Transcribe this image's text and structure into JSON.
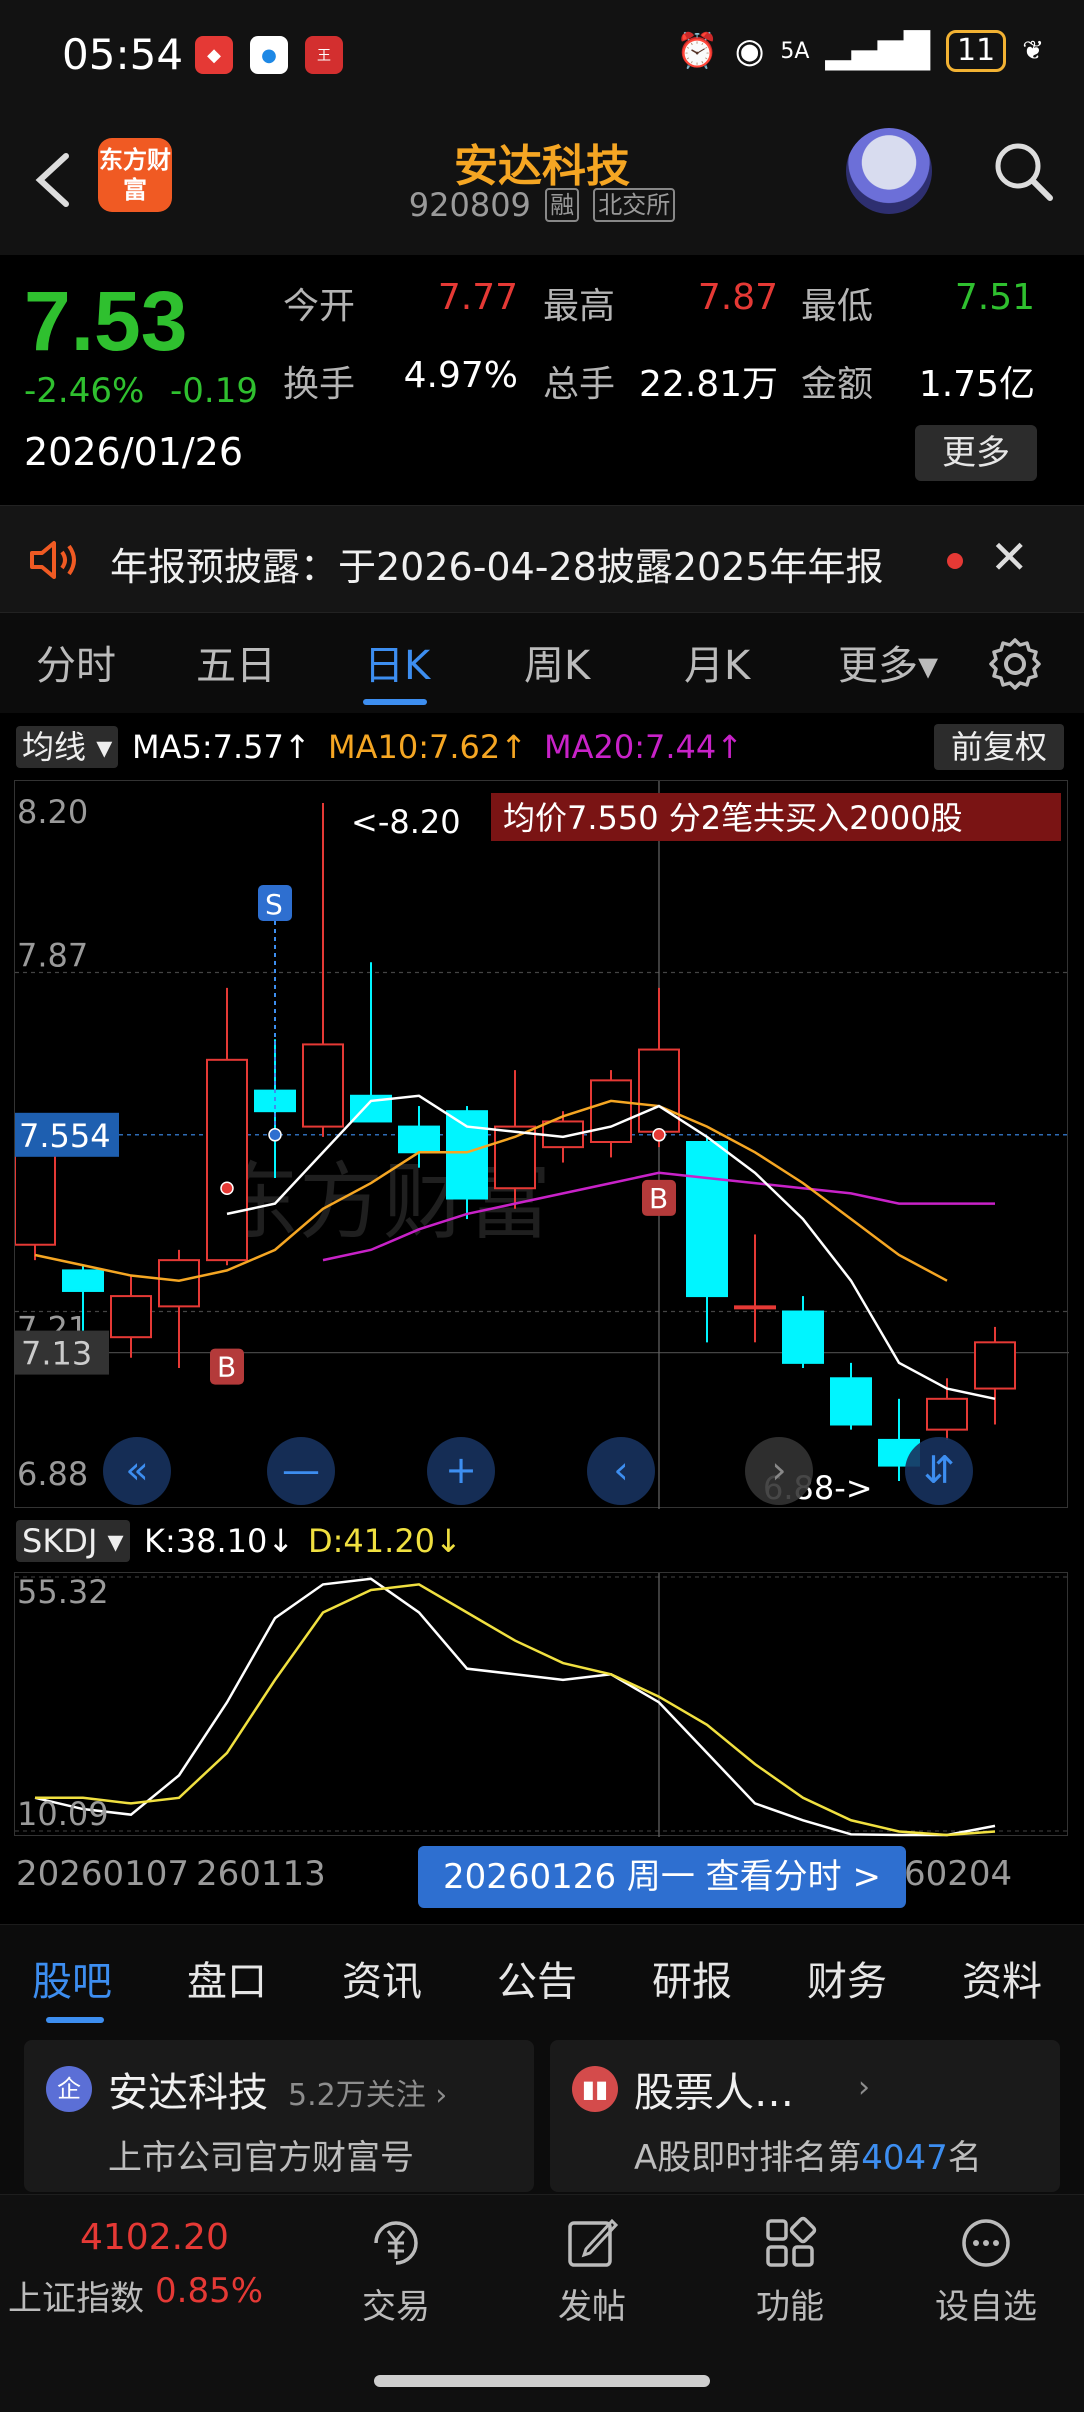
{
  "status_bar": {
    "time": "05:54",
    "network": "5A",
    "battery": "11"
  },
  "header": {
    "app_logo_text": "东方财富",
    "stock_name": "安达科技",
    "stock_code": "920809",
    "margin_tag": "融",
    "exchange_tag": "北交所"
  },
  "quote": {
    "last_price": "7.53",
    "change_pct": "-2.46%",
    "change_abs": "-0.19",
    "date": "2026/01/26",
    "fields": [
      {
        "label": "今开",
        "value": "7.77",
        "color": "#e53935"
      },
      {
        "label": "最高",
        "value": "7.87",
        "color": "#e53935"
      },
      {
        "label": "最低",
        "value": "7.51",
        "color": "#2fc02f"
      },
      {
        "label": "换手",
        "value": "4.97%",
        "color": "#ffffff"
      },
      {
        "label": "总手",
        "value": "22.81万",
        "color": "#ffffff"
      },
      {
        "label": "金额",
        "value": "1.75亿",
        "color": "#ffffff"
      }
    ],
    "more_label": "更多"
  },
  "notice": {
    "text": "年报预披露：于2026-04-28披露2025年年报"
  },
  "period_tabs": {
    "items": [
      "分时",
      "五日",
      "日K",
      "周K",
      "月K",
      "更多▾"
    ],
    "active": "日K"
  },
  "ma_bar": {
    "selector": "均线",
    "ma5": "MA5:7.57↑",
    "ma10": "MA10:7.62↑",
    "ma20": "MA20:7.44↑",
    "adjust": "前复权"
  },
  "kdj_bar": {
    "selector": "SKDJ",
    "k": "K:38.10↓",
    "d": "D:41.20↓"
  },
  "colors": {
    "up": "#e53935",
    "down": "#00f5ff",
    "ma5": "#ffffff",
    "ma10": "#f5a623",
    "ma20": "#c822c8",
    "k_line": "#ffffff",
    "d_line": "#f0e040",
    "accent": "#3d8ef0"
  },
  "chart_data": [
    {
      "type": "candlestick",
      "y_ticks": [
        "8.20",
        "7.87",
        "7.554",
        "7.21",
        "7.13",
        "6.88"
      ],
      "ylim": [
        6.88,
        8.2
      ],
      "crosshair_value": "7.554",
      "max_label": "<-8.20",
      "min_label": "6.88->",
      "banner": "均价7.550  分2笔共买入2000股",
      "candles": [
        {
          "o": 7.34,
          "h": 7.52,
          "l": 7.31,
          "c": 7.52
        },
        {
          "o": 7.29,
          "h": 7.3,
          "l": 7.15,
          "c": 7.25
        },
        {
          "o": 7.16,
          "h": 7.28,
          "l": 7.12,
          "c": 7.24
        },
        {
          "o": 7.22,
          "h": 7.33,
          "l": 7.1,
          "c": 7.31
        },
        {
          "o": 7.31,
          "h": 7.84,
          "l": 7.3,
          "c": 7.7
        },
        {
          "o": 7.64,
          "h": 7.74,
          "l": 7.47,
          "c": 7.6
        },
        {
          "o": 7.57,
          "h": 8.2,
          "l": 7.55,
          "c": 7.73
        },
        {
          "o": 7.63,
          "h": 7.89,
          "l": 7.58,
          "c": 7.58
        },
        {
          "o": 7.57,
          "h": 7.61,
          "l": 7.49,
          "c": 7.52
        },
        {
          "o": 7.6,
          "h": 7.61,
          "l": 7.39,
          "c": 7.43
        },
        {
          "o": 7.45,
          "h": 7.68,
          "l": 7.41,
          "c": 7.57
        },
        {
          "o": 7.53,
          "h": 7.6,
          "l": 7.5,
          "c": 7.58
        },
        {
          "o": 7.54,
          "h": 7.68,
          "l": 7.51,
          "c": 7.66
        },
        {
          "o": 7.56,
          "h": 7.84,
          "l": 7.53,
          "c": 7.72
        },
        {
          "o": 7.54,
          "h": 7.55,
          "l": 7.15,
          "c": 7.24
        },
        {
          "o": 7.22,
          "h": 7.36,
          "l": 7.15,
          "c": 7.22
        },
        {
          "o": 7.21,
          "h": 7.24,
          "l": 7.1,
          "c": 7.11
        },
        {
          "o": 7.08,
          "h": 7.11,
          "l": 6.98,
          "c": 6.99
        },
        {
          "o": 6.96,
          "h": 7.04,
          "l": 6.88,
          "c": 6.91
        },
        {
          "o": 6.98,
          "h": 7.08,
          "l": 6.96,
          "c": 7.04
        },
        {
          "o": 7.06,
          "h": 7.18,
          "l": 6.99,
          "c": 7.15
        }
      ],
      "ma5": [
        null,
        null,
        null,
        null,
        7.4,
        7.42,
        7.52,
        7.62,
        7.63,
        7.57,
        7.56,
        7.55,
        7.57,
        7.61,
        7.55,
        7.48,
        7.39,
        7.27,
        7.11,
        7.06,
        7.04
      ],
      "ma10": [
        7.32,
        7.3,
        7.28,
        7.27,
        7.29,
        7.33,
        7.41,
        7.46,
        7.52,
        7.52,
        7.55,
        7.59,
        7.62,
        7.61,
        7.57,
        7.52,
        7.46,
        7.39,
        7.32,
        7.27
      ],
      "ma20": [
        null,
        null,
        null,
        null,
        null,
        null,
        7.31,
        7.33,
        7.37,
        7.4,
        7.42,
        7.44,
        7.46,
        7.48,
        7.47,
        7.46,
        7.45,
        7.44,
        7.42,
        7.42,
        7.42
      ],
      "markers": [
        {
          "index": 5,
          "label": "S"
        },
        {
          "index": 4,
          "label": "B"
        },
        {
          "index": 13,
          "label": "B"
        }
      ]
    },
    {
      "type": "line",
      "title": "SKDJ",
      "y_ticks": [
        "55.32",
        "10.09"
      ],
      "ylim": [
        10.09,
        55.32
      ],
      "series": [
        {
          "name": "K",
          "values": [
            16,
            14,
            13,
            20,
            33,
            48,
            54,
            55,
            49,
            39,
            38,
            37,
            38,
            33,
            24,
            15,
            12,
            9.5,
            8,
            8,
            11
          ]
        },
        {
          "name": "D",
          "values": [
            16,
            16,
            15,
            16,
            24,
            37,
            49,
            53,
            54,
            49,
            44,
            40,
            38,
            34,
            29,
            22,
            16,
            12,
            10,
            9,
            10
          ]
        }
      ]
    }
  ],
  "date_axis": {
    "left": "20260107",
    "mid": "260113",
    "right": "60204",
    "tooltip": "20260126 周一 查看分时 >"
  },
  "bottom_tabs": {
    "items": [
      "股吧",
      "盘口",
      "资讯",
      "公告",
      "研报",
      "财务",
      "资料"
    ],
    "active": "股吧"
  },
  "cards": [
    {
      "icon_text": "企",
      "title": "安达科技",
      "sub": "5.2万关注 ›",
      "desc": "上市公司官方财富号"
    },
    {
      "title": "股票人…",
      "sub": "›",
      "desc_prefix": "A股即时排名第",
      "desc_rank": "4047",
      "desc_suffix": "名"
    }
  ],
  "bottom_nav": {
    "index_value": "4102.20",
    "index_name": "上证指数",
    "index_change": "0.85%",
    "items": [
      "交易",
      "发帖",
      "功能",
      "设自选"
    ]
  }
}
